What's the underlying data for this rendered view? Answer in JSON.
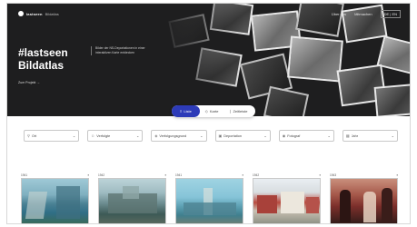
{
  "header": {
    "logo_text": "lastseen",
    "logo_sub": "Bildatlas",
    "nav": [
      "Über uns",
      "Mitmachen",
      "DE | EN"
    ]
  },
  "hero": {
    "title_line1": "#lastseen",
    "title_line2": "Bildatlas",
    "description": "Bilder der NS-Deportationen in einer interaktiven Karte entdecken",
    "link": "Zum Projekt"
  },
  "tabs": [
    {
      "label": "Liste",
      "active": true,
      "icon": "list-icon"
    },
    {
      "label": "Karte",
      "active": false,
      "icon": "map-icon"
    },
    {
      "label": "Zeitleiste",
      "active": false,
      "icon": "timeline-icon"
    }
  ],
  "filters": [
    {
      "label": "Ort",
      "icon": "pin-icon"
    },
    {
      "label": "Verfolgte",
      "icon": "person-icon"
    },
    {
      "label": "Verfolgungsgrund",
      "icon": "tag-icon"
    },
    {
      "label": "Deportation",
      "icon": "train-icon"
    },
    {
      "label": "Fotograf",
      "icon": "camera-icon"
    },
    {
      "label": "Jahr",
      "icon": "calendar-icon"
    }
  ],
  "cards": [
    {
      "date": "1941",
      "style": "img1"
    },
    {
      "date": "1942",
      "style": "img2"
    },
    {
      "date": "1941",
      "style": "img3"
    },
    {
      "date": "1942",
      "style": "img4"
    },
    {
      "date": "1943",
      "style": "img5"
    }
  ],
  "colors": {
    "accent": "#2d3bb8",
    "hero_bg": "#1e1e1f"
  }
}
